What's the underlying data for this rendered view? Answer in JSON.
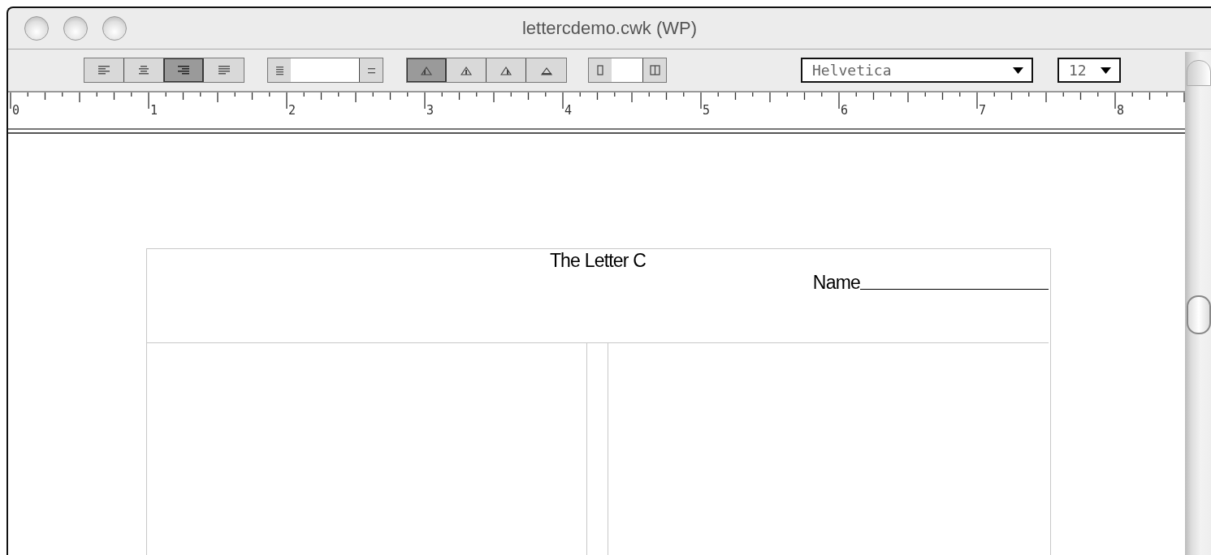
{
  "window": {
    "title": "lettercdemo.cwk (WP)"
  },
  "toolbar": {
    "alignment": [
      {
        "kind": "left",
        "selected": false
      },
      {
        "kind": "center",
        "selected": false
      },
      {
        "kind": "right",
        "selected": true
      },
      {
        "kind": "justify",
        "selected": false
      }
    ],
    "tab_stops": [
      {
        "kind": "left",
        "selected": true
      },
      {
        "kind": "center",
        "selected": false
      },
      {
        "kind": "right",
        "selected": false
      },
      {
        "kind": "decimal",
        "selected": false
      }
    ],
    "font": {
      "value": "Helvetica"
    },
    "size": {
      "value": "12"
    }
  },
  "ruler": {
    "labels": [
      "0",
      "1",
      "2",
      "3",
      "4",
      "5",
      "6",
      "7",
      "8"
    ]
  },
  "document": {
    "title": "The Letter C",
    "name_label": "Name"
  }
}
